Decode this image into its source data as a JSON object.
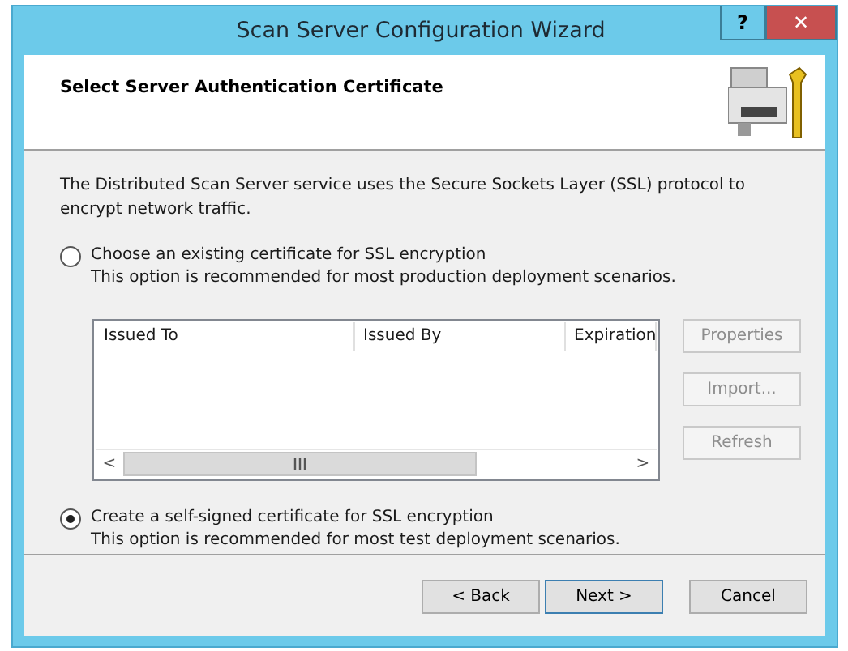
{
  "window": {
    "title": "Scan Server Configuration Wizard",
    "help_button": "?",
    "close_button": "✕"
  },
  "header": {
    "title": "Select Server Authentication Certificate"
  },
  "intro": "The Distributed Scan Server service uses the Secure Sockets Layer (SSL) protocol to encrypt network traffic.",
  "options": [
    {
      "label": "Choose an existing certificate for SSL encryption",
      "description": "This option is recommended for most production deployment scenarios.",
      "selected": false
    },
    {
      "label": "Create a self-signed certificate for SSL encryption",
      "description": "This option is recommended for most test deployment scenarios.",
      "selected": true
    }
  ],
  "certificate_list": {
    "columns": [
      "Issued To",
      "Issued By",
      "Expiration"
    ],
    "scroll_left": "<",
    "scroll_right": ">"
  },
  "side_buttons": [
    {
      "label": "Properties",
      "disabled": true
    },
    {
      "label": "Import...",
      "disabled": true
    },
    {
      "label": "Refresh",
      "disabled": true
    }
  ],
  "footer_buttons": [
    {
      "label": "< Back",
      "default": false
    },
    {
      "label": "Next >",
      "default": true
    },
    {
      "label": "Cancel",
      "default": false
    }
  ]
}
